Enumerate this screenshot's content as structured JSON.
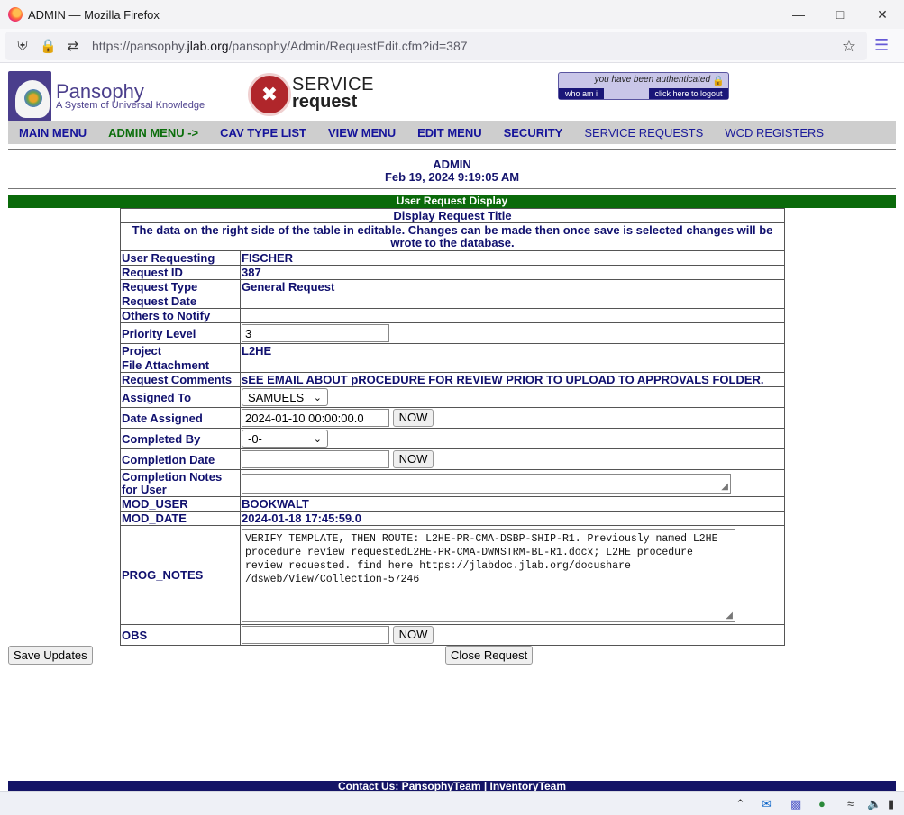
{
  "browser": {
    "title": "ADMIN — Mozilla Firefox",
    "url_prefix": "https://pansophy.",
    "url_host": "jlab.org",
    "url_path": "/pansophy/Admin/RequestEdit.cfm?id=387"
  },
  "header": {
    "brand": "Pansophy",
    "brand_sub": "A System of Universal Knowledge",
    "service_t1": "SERVICE",
    "service_t2": "request",
    "auth_msg": "you have been authenticated",
    "who_am_i": "who am i",
    "logout": "click here to logout"
  },
  "menu": {
    "items": [
      {
        "label": "MAIN MENU"
      },
      {
        "label": "ADMIN MENU ->"
      },
      {
        "label": "CAV TYPE LIST"
      },
      {
        "label": "VIEW MENU"
      },
      {
        "label": "EDIT MENU"
      },
      {
        "label": "SECURITY"
      },
      {
        "label": "SERVICE REQUESTS"
      },
      {
        "label": "WCD REGISTERS"
      }
    ]
  },
  "page": {
    "role": "ADMIN",
    "timestamp": "Feb 19, 2024 9:19:05 AM",
    "section_title": "User Request Display",
    "table_title": "Display Request Title",
    "instructions": "The data on the right side of the table in editable. Changes can be made then once save is selected changes will be wrote to the database."
  },
  "fields": {
    "user_requesting": {
      "label": "User Requesting",
      "value": "FISCHER"
    },
    "request_id": {
      "label": "Request ID",
      "value": "387"
    },
    "request_type": {
      "label": "Request Type",
      "value": "General Request"
    },
    "request_date": {
      "label": "Request Date",
      "value": ""
    },
    "others_to_notify": {
      "label": "Others to Notify",
      "value": ""
    },
    "priority_level": {
      "label": "Priority Level",
      "value": "3"
    },
    "project": {
      "label": "Project",
      "value": "L2HE"
    },
    "file_attachment": {
      "label": "File Attachment",
      "value": ""
    },
    "request_comments": {
      "label": "Request Comments",
      "value": "sEE EMAIL ABOUT pROCEDURE FOR REVIEW PRIOR TO UPLOAD TO APPROVALS FOLDER."
    },
    "assigned_to": {
      "label": "Assigned To",
      "value": "SAMUELS"
    },
    "date_assigned": {
      "label": "Date Assigned",
      "value": "2024-01-10 00:00:00.0"
    },
    "completed_by": {
      "label": "Completed By",
      "value": "-0-"
    },
    "completion_date": {
      "label": "Completion Date",
      "value": ""
    },
    "completion_notes": {
      "label": "Completion Notes for User",
      "value": ""
    },
    "mod_user": {
      "label": "MOD_USER",
      "value": "BOOKWALT"
    },
    "mod_date": {
      "label": "MOD_DATE",
      "value": "2024-01-18 17:45:59.0"
    },
    "prog_notes": {
      "label": "PROG_NOTES",
      "value": "VERIFY TEMPLATE, THEN ROUTE: L2HE-PR-CMA-DSBP-SHIP-R1. Previously named L2HE procedure review requestedL2HE-PR-CMA-DWNSTRM-BL-R1.docx; L2HE procedure review requested. find here https://jlabdoc.jlab.org/docushare /dsweb/View/Collection-57246"
    },
    "obs": {
      "label": "OBS",
      "value": ""
    }
  },
  "buttons": {
    "now": "NOW",
    "save": "Save Updates",
    "close": "Close Request"
  },
  "footer": {
    "text": "Contact Us: PansophyTeam | InventoryTeam"
  }
}
